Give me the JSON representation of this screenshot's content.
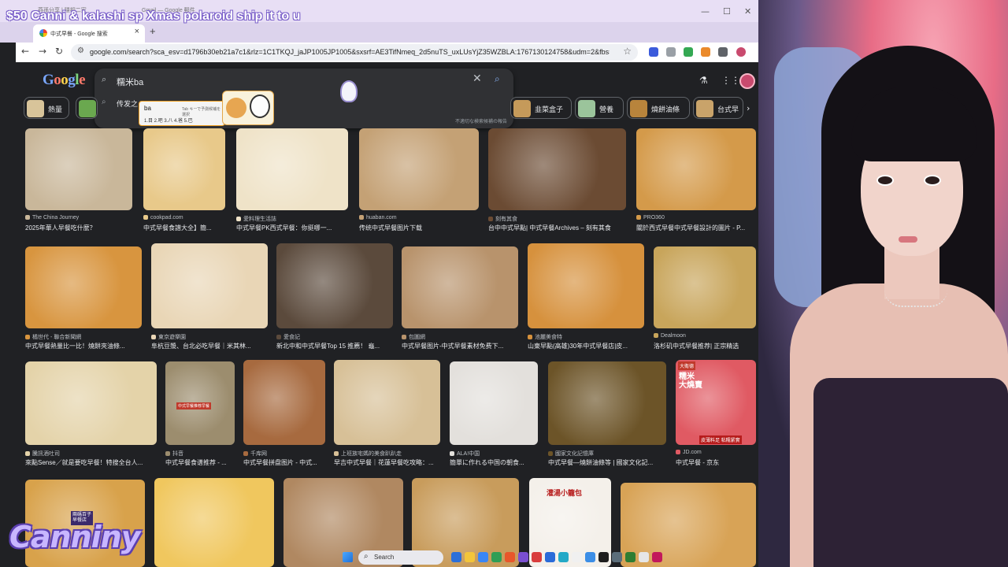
{
  "stream": {
    "donation_alert": "$50 Canni & kalashi sp Xmas polaroid ship it to u",
    "channel_logo": "Canniny"
  },
  "browser": {
    "background_tabs": [
      "燕孫分享 | 隱相二家",
      "Gmail — Google 郵件"
    ],
    "window_controls": [
      "—",
      "☐",
      "✕"
    ],
    "active_tab_title": "中式早餐 - Google 搜索",
    "new_tab": "+",
    "url": "google.com/search?sca_esv=d1796b30eb21a7c1&rlz=1C1TKQJ_jaJP1005JP1005&sxsrf=AE3TifNmeq_2d5nuTS_uxLUsYjZ35WZBLA:1767130124758&udm=2&fbs=AIIjpHzQki16q-8Z..."
  },
  "google": {
    "logo_letters": [
      "G",
      "o",
      "o",
      "g",
      "l",
      "e"
    ],
    "search_query": "糯米ba",
    "suggestion": "传发之",
    "report_link": "不適切な検索候補の報告",
    "ime": {
      "input": "ba",
      "hint": "Tab キーで予測候補を選択",
      "candidates": "1.目  2.吧  3.八  4.爸  5.巴"
    }
  },
  "chips": [
    {
      "label": "熱量",
      "color": "#d8c49a"
    },
    {
      "label": "",
      "color": "#6aa84f"
    },
    {
      "label": "韭菜盒子",
      "color": "#c59a5a"
    },
    {
      "label": "營養",
      "color": "#9bc49b"
    },
    {
      "label": "燒餅油條",
      "color": "#b8843c"
    },
    {
      "label": "台式早",
      "color": "#c9a36a"
    }
  ],
  "results": [
    {
      "source": "The China Journey",
      "caption": "2025年華人早餐吃什麼？",
      "color": "#c9b79a"
    },
    {
      "source": "cookpad.com",
      "caption": "中式早餐食譜大全】簡...",
      "color": "#e8c98a"
    },
    {
      "source": "愛料理生活誌",
      "caption": "中式早餐PK西式早餐：你挺哪一...",
      "color": "#efe3c8"
    },
    {
      "source": "huaban.com",
      "caption": "传统中式早餐图片下载",
      "color": "#c4a175"
    },
    {
      "source": "刻有其食",
      "caption": "台中中式早點| 中式早餐Archives – 刻有其食",
      "color": "#6b4b33"
    },
    {
      "source": "PRO360",
      "caption": "關於西式早餐中式早餐設計的圖片 - P...",
      "color": "#d49a4a"
    },
    {
      "source": "橘世代 - 聯合新聞網",
      "caption": "中式早餐熱量比一比！燒餅夾油條...",
      "color": "#d8953f"
    },
    {
      "source": "東京遊樂園",
      "caption": "阜杭豆漿、台北必吃早餐｜米其林...",
      "color": "#e9d6b6"
    },
    {
      "source": "愛食記",
      "caption": "新北中和中式早餐Top 15 推薦！ 龜...",
      "color": "#5b4a3c"
    },
    {
      "source": "包圖網",
      "caption": "中式早餐图片-中式早餐素材免费下...",
      "color": "#b8936c"
    },
    {
      "source": "池麗美食特",
      "caption": "山東早點(高雄)30年中式早餐店|皮...",
      "color": "#d6913d"
    },
    {
      "source": "Dealmoon",
      "caption": "洛杉矶中式早餐推荐| 正宗精选",
      "color": "#c8a55b"
    },
    {
      "source": "騰訊酒吐司",
      "caption": "來點Sense／就是要吃早餐！特搜全台人...",
      "color": "#e4d3a9"
    },
    {
      "source": "抖音",
      "caption": "中式早餐食谱推荐 - ...",
      "color": "#9c8d6e"
    },
    {
      "source": "千库网",
      "caption": "中式早餐拼盘图片 - 中式...",
      "color": "#a76a3f"
    },
    {
      "source": "上班族宅媽的美食趴趴走",
      "caption": "早吉中式早餐｜花蓮早餐吃攻略：...",
      "color": "#d7c097"
    },
    {
      "source": "ALA!中国",
      "caption": "簡單に作れる中国の朝食...",
      "color": "#e3e0dc"
    },
    {
      "source": "國家文化記憶庫",
      "caption": "中式早餐—燒餅油條等 | 國家文化記...",
      "color": "#6c5428"
    },
    {
      "source": "JD.com",
      "caption": "中式早餐 - 京东",
      "color": "#e05a63"
    },
    {
      "source": "",
      "caption": "",
      "color": "#d8a24b"
    },
    {
      "source": "",
      "caption": "",
      "color": "#f0c75e"
    },
    {
      "source": "",
      "caption": "",
      "color": "#b08861"
    },
    {
      "source": "",
      "caption": "",
      "color": "#c89c5c"
    },
    {
      "source": "",
      "caption": "",
      "color": "#f4f0ea"
    },
    {
      "source": "",
      "caption": "",
      "color": "#d8a356"
    }
  ],
  "thumb_texts": {
    "jd_badge": "大衛德",
    "jd_title": "糯米\n大燒賣",
    "jd_bottom": "皮薄料足 粘糯紧實",
    "xlb_title": "灌湯小籠包",
    "douyin_title": "中式早餐推荐早餐",
    "bottom_tile_sign": "兩碼百子\n早餐店"
  },
  "taskbar": {
    "search_placeholder": "Search",
    "apps": [
      "#2b6fd8",
      "#f3c53a",
      "#3a86f5",
      "#2f9e55",
      "#e8562a",
      "#7a4fd0",
      "#d93d3d",
      "#2a6bd9",
      "#24a9c7",
      "#f0f0f0",
      "#3c8ee6",
      "#1e1e1e",
      "#5b6d7a",
      "#2e7d32",
      "#e6e6e6",
      "#c2185b"
    ]
  },
  "accent_colors": {
    "google_blue": "#8ab4f8",
    "page_bg": "#202124",
    "stream_purple": "#7a5fc9"
  }
}
